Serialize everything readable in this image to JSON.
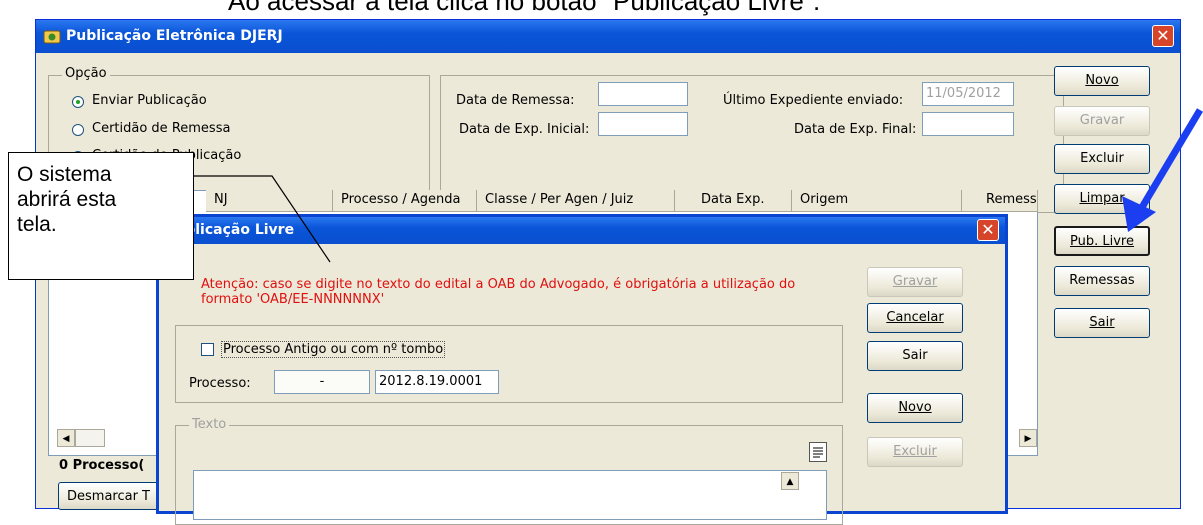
{
  "caption": "Ao acessar a tela clica no botão \"Publicação Livre\".",
  "window": {
    "title": "Publicação Eletrônica DJERJ",
    "close": "✕"
  },
  "opcao": {
    "legend": "Opção",
    "options": [
      {
        "label": "Enviar Publicação",
        "selected": true
      },
      {
        "label": "Certidão de Remessa",
        "selected": false
      },
      {
        "label": "Certidão de Publicação",
        "selected": false
      }
    ]
  },
  "filters": {
    "data_remessa_label": "Data de Remessa:",
    "data_remessa_value": "",
    "ultimo_exp_label": "Último Expediente enviado:",
    "ultimo_exp_value": "11/05/2012",
    "data_exp_inicial_label": "Data de Exp. Inicial:",
    "data_exp_inicial_value": "",
    "data_exp_final_label": "Data de Exp.  Final:",
    "data_exp_final_value": ""
  },
  "grid": {
    "columns": [
      "NJ",
      "Processo / Agenda",
      "Classe / Per Agen / Juiz",
      "Data Exp.",
      "Origem",
      "Remessa"
    ],
    "count_label": "0 Processo(",
    "desmarcar_label": "Desmarcar T"
  },
  "side_buttons": [
    {
      "label": "Novo",
      "disabled": false
    },
    {
      "label": "Gravar",
      "disabled": true
    },
    {
      "label": "Excluir",
      "disabled": false
    },
    {
      "label": "Limpar",
      "disabled": false
    },
    {
      "label": "Pub. Livre",
      "disabled": false
    },
    {
      "label": "Remessas",
      "disabled": false
    },
    {
      "label": "Sair",
      "disabled": false
    }
  ],
  "dialog": {
    "title": "Publicação Livre",
    "warning_line1": "Atenção: caso se digite no texto do edital a OAB do Advogado, é obrigatória a utilização do",
    "warning_line2": "formato 'OAB/EE-NNNNNNX'",
    "checkbox_label": "Processo Antigo ou com nº tombo",
    "processo_label": "Processo:",
    "processo_part1": "-",
    "processo_part2": "2012.8.19.0001",
    "texto_legend": "Texto",
    "buttons": [
      {
        "label": "Gravar",
        "disabled": true
      },
      {
        "label": "Cancelar",
        "disabled": false
      },
      {
        "label": "Sair",
        "disabled": false
      },
      {
        "label": "Novo",
        "disabled": false
      },
      {
        "label": "Excluir",
        "disabled": true
      }
    ]
  },
  "callout": {
    "line1": "O sistema",
    "line2": "abrirá esta",
    "line3": "tela."
  },
  "colors": {
    "titlebar": "#0a55d8",
    "warning": "#e01010",
    "arrow": "#1b3ff0"
  }
}
